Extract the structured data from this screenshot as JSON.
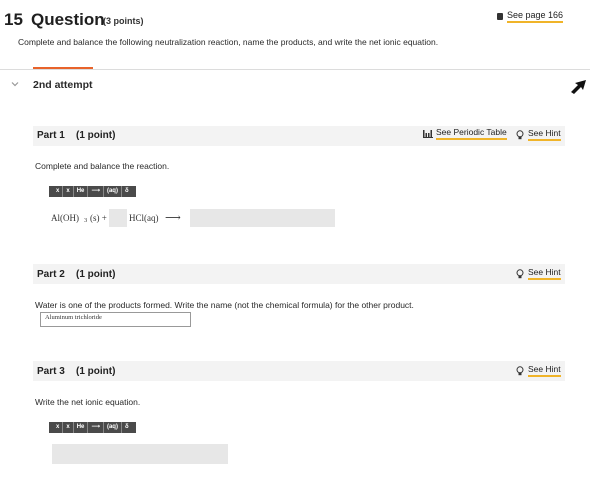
{
  "question": {
    "number": "15",
    "word": "Question",
    "points": "(3 points)",
    "see_page": "See page 166",
    "instructions": "Complete and balance the following neutralization reaction, name the products, and write the net ionic equation."
  },
  "attempt": {
    "label": "2nd attempt"
  },
  "part1": {
    "title": "Part 1",
    "points": "(1 point)",
    "periodic_table": "See Periodic Table",
    "hint": "See Hint",
    "prompt": "Complete and balance the reaction.",
    "toolbar": [
      "x",
      "x",
      "He",
      "⟶",
      "(aq)",
      "δ"
    ],
    "eq_left": "Al(OH)",
    "eq_sub": "3",
    "eq_state": "(s)  +",
    "eq_hcl": "HCl(aq)",
    "eq_arrow": "⟶"
  },
  "part2": {
    "title": "Part 2",
    "points": "(1 point)",
    "hint": "See Hint",
    "prompt": "Water is one of the products formed. Write the name (not the chemical formula) for the other product.",
    "answer_value": "Aluminum trichloride"
  },
  "part3": {
    "title": "Part 3",
    "points": "(1 point)",
    "hint": "See Hint",
    "prompt": "Write the net ionic equation.",
    "toolbar": [
      "x",
      "x",
      "He",
      "⟶",
      "(aq)",
      "δ"
    ]
  },
  "colors": {
    "accent_orange": "#e8632b",
    "link_underline": "#f0b429",
    "band_bg": "#f3f3f3",
    "toolbar_bg": "#4a4a4a"
  }
}
